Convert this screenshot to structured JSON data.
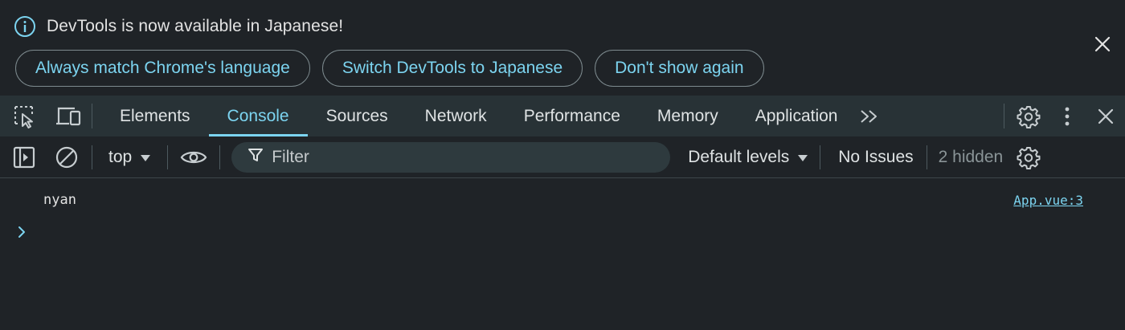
{
  "infobar": {
    "message": "DevTools is now available in Japanese!",
    "buttons": {
      "match": "Always match Chrome's language",
      "switch": "Switch DevTools to Japanese",
      "dismiss": "Don't show again"
    },
    "icons": {
      "info": "info-icon",
      "close": "close-icon"
    }
  },
  "tabbar": {
    "tabs": [
      "Elements",
      "Console",
      "Sources",
      "Network",
      "Performance",
      "Memory",
      "Application"
    ],
    "active_tab": "Console",
    "icons": [
      "inspect-element-icon",
      "device-toolbar-icon",
      "more-tabs-icon",
      "settings-icon",
      "kebab-menu-icon",
      "close-icon"
    ]
  },
  "console_toolbar": {
    "context": "top",
    "filter_placeholder": "Filter",
    "levels": "Default levels",
    "issues": "No Issues",
    "hidden": "2 hidden",
    "icons": [
      "sidebar-toggle-icon",
      "clear-console-icon",
      "live-expression-eye-icon",
      "filter-icon",
      "console-settings-icon"
    ]
  },
  "console": {
    "messages": [
      {
        "text": "nyan",
        "source": "App.vue:3"
      }
    ],
    "prompt_icon": "chevron-right-icon"
  },
  "colors": {
    "accent": "#7cd4f0",
    "background": "#1f2327",
    "tabbar": "#283236"
  }
}
